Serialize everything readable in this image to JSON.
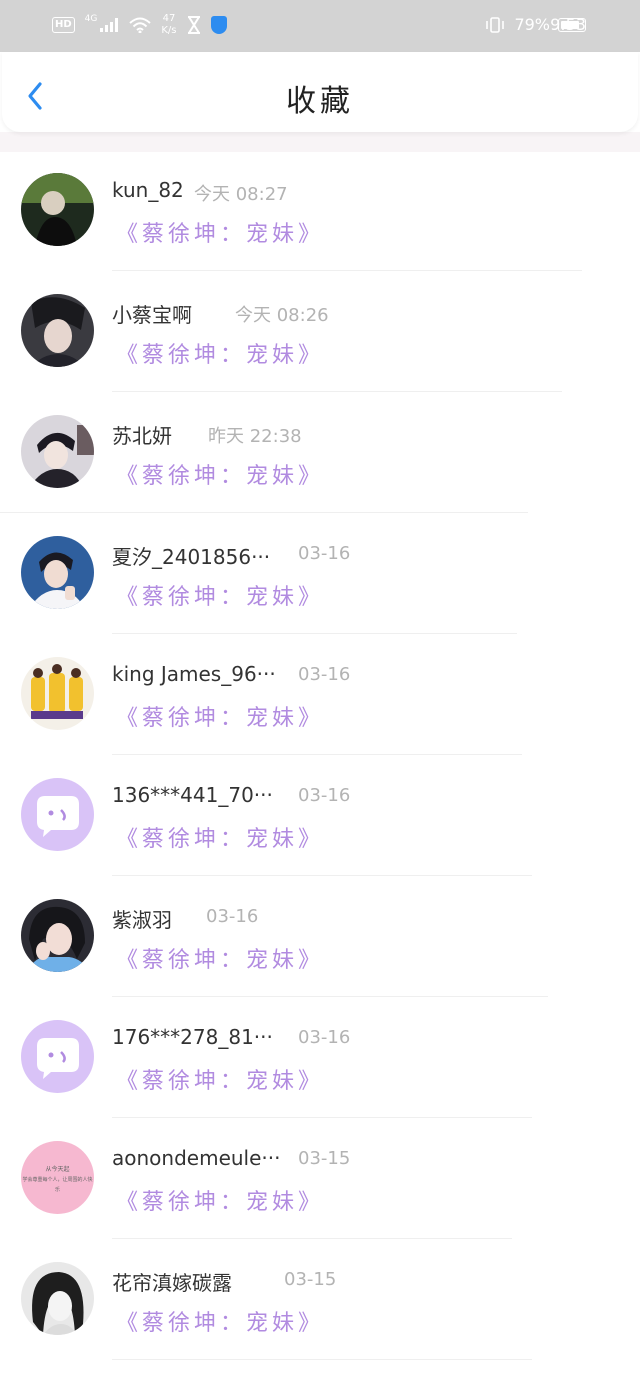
{
  "status_bar": {
    "hd": "HD",
    "network": "4G",
    "speed_value": "47",
    "speed_unit": "K/s",
    "battery": "79%",
    "time": "9:53"
  },
  "header": {
    "title": "收藏"
  },
  "items": [
    {
      "name": "kun_82",
      "time": "今天 08:27",
      "book": "《蔡徐坤：宠妹》"
    },
    {
      "name": "小蔡宝啊",
      "time": "今天 08:26",
      "book": "《蔡徐坤：宠妹》"
    },
    {
      "name": "苏北妍",
      "time": "昨天 22:38",
      "book": "《蔡徐坤：宠妹》"
    },
    {
      "name": "夏汐_2401856···",
      "time": "03-16",
      "book": "《蔡徐坤：宠妹》"
    },
    {
      "name": "king James_96···",
      "time": "03-16",
      "book": "《蔡徐坤：宠妹》"
    },
    {
      "name": "136***441_70···",
      "time": "03-16",
      "book": "《蔡徐坤：宠妹》"
    },
    {
      "name": "紫淑羽",
      "time": "03-16",
      "book": "《蔡徐坤：宠妹》"
    },
    {
      "name": "176***278_81···",
      "time": "03-16",
      "book": "《蔡徐坤：宠妹》"
    },
    {
      "name": "aonondemeule···",
      "time": "03-15",
      "book": "《蔡徐坤：宠妹》",
      "avatar_text_1": "从今天起",
      "avatar_text_2": "学会尊重每个人，让周围的人快乐"
    },
    {
      "name": "花帘滇嫁碳露",
      "time": "03-15",
      "book": "《蔡徐坤：宠妹》"
    }
  ],
  "colors": {
    "accent_blue": "#2d8cf0",
    "book_purple": "#b18be0",
    "default_avatar": "#d9c3f7",
    "status_bar_bg": "#d3d3d3"
  }
}
